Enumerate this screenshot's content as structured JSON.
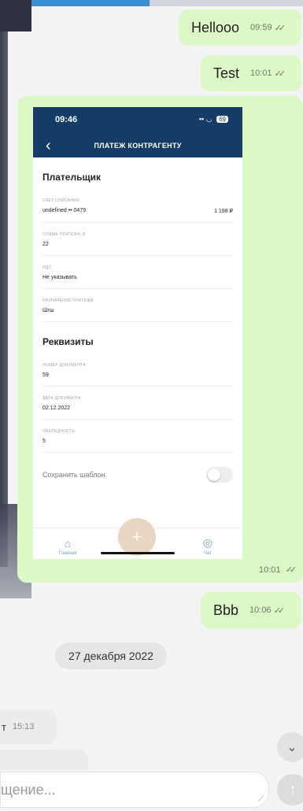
{
  "messages": [
    {
      "text": "Hellooo",
      "time": "09:59",
      "status": "read"
    },
    {
      "text": "Test",
      "time": "10:01",
      "status": "read"
    },
    {
      "image_time": "10:01",
      "status": "read"
    },
    {
      "text": "Bbb",
      "time": "10:06",
      "status": "read"
    }
  ],
  "date_separator": "27 декабря 2022",
  "incoming": {
    "partial_text": "т",
    "time": "15:13"
  },
  "composer": {
    "placeholder": "щение..."
  },
  "check_glyph": "✓✓",
  "colors": {
    "outgoing_bubble": "#dcf8c6",
    "phone_header": "#153c66"
  },
  "phone_screenshot": {
    "status_time": "09:46",
    "status_battery": "69",
    "title": "ПЛАТЕЖ КОНТРАГЕНТУ",
    "section_payer": "Плательщик",
    "fields_payer": [
      {
        "label": "СЧЕТ СПИСАНИЯ",
        "value": "undefined •• 0479",
        "extra": "1 198 ₽"
      },
      {
        "label": "СУММА ПЛАТЕЖА, ₽",
        "value": "22",
        "extra": ""
      },
      {
        "label": "НДС",
        "value": "Не указывать",
        "extra": ""
      },
      {
        "label": "НАЗНАЧЕНИЕ ПЛАТЕЖА",
        "value": "Шгш",
        "extra": ""
      }
    ],
    "section_details": "Реквизиты",
    "fields_details": [
      {
        "label": "НОМЕР ДОКУМЕНТА",
        "value": "59"
      },
      {
        "label": "ДАТА ДОКУМЕНТА",
        "value": "02.12.2022"
      },
      {
        "label": "ОЧЕРЕДНОСТЬ",
        "value": "5"
      }
    ],
    "save_template": "Сохранить шаблон",
    "tab_home": "Главная",
    "tab_chat": "Чат"
  }
}
